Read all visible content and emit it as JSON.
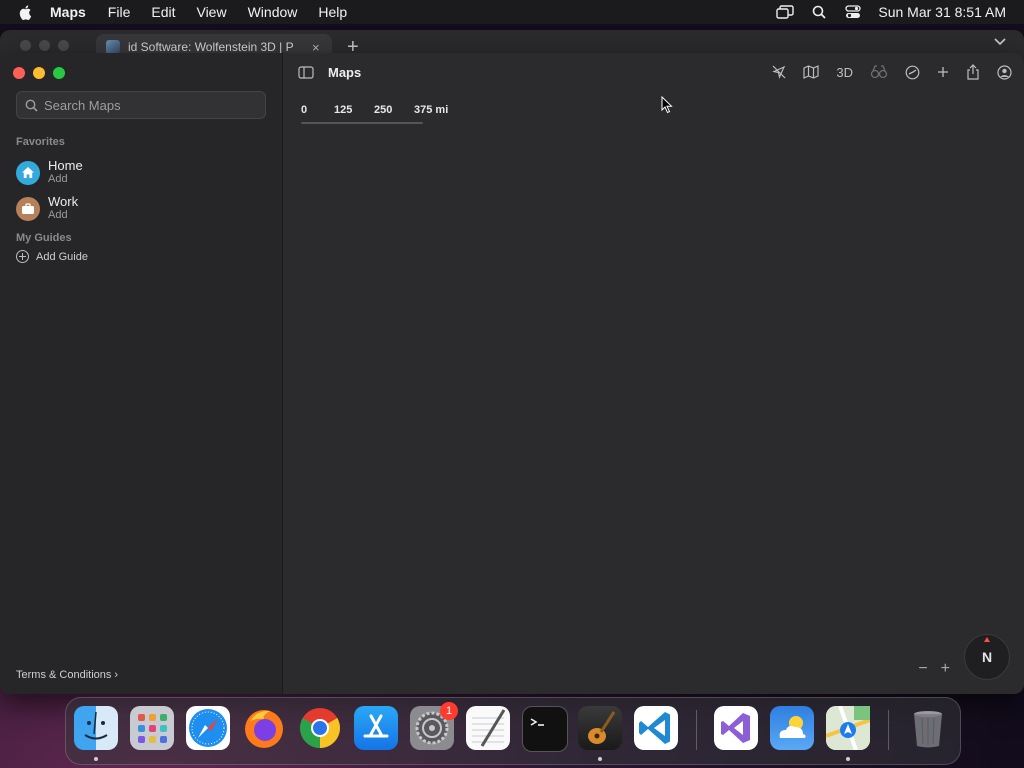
{
  "menubar": {
    "app_name": "Maps",
    "items": [
      "File",
      "Edit",
      "View",
      "Window",
      "Help"
    ],
    "clock": "Sun Mar 31  8:51 AM"
  },
  "browser_window": {
    "tab_title": "id Software: Wolfenstein 3D | P",
    "close_glyph": "×",
    "new_tab_glyph": "+"
  },
  "maps": {
    "title": "Maps",
    "search_placeholder": "Search Maps",
    "favorites_heading": "Favorites",
    "favorites": [
      {
        "label": "Home",
        "sub": "Add",
        "color": "#34aadc"
      },
      {
        "label": "Work",
        "sub": "Add",
        "color": "#b5805a"
      }
    ],
    "guides_heading": "My Guides",
    "add_guide": "Add Guide",
    "terms": "Terms & Conditions ›",
    "toolbar": {
      "threed_label": "3D",
      "icons": [
        "location-icon",
        "map-mode-icon",
        "3d-button",
        "look-around-icon",
        "tracking-icon",
        "add-icon",
        "share-icon",
        "account-icon"
      ]
    },
    "scale": {
      "labels": [
        "0",
        "125",
        "250",
        "375 mi"
      ]
    },
    "zoom_out": "−",
    "zoom_in": "+",
    "compass_label": "N"
  },
  "dock": {
    "apps": [
      "finder-icon",
      "launchpad-icon",
      "safari-icon",
      "firefox-icon",
      "chrome-icon",
      "app-store-icon",
      "system-settings-icon",
      "textedit-icon",
      "terminal-icon",
      "garageband-icon",
      "vscode-icon",
      "visual-studio-icon",
      "weather-icon",
      "maps-icon",
      "trash-icon"
    ],
    "settings_badge": "1"
  }
}
